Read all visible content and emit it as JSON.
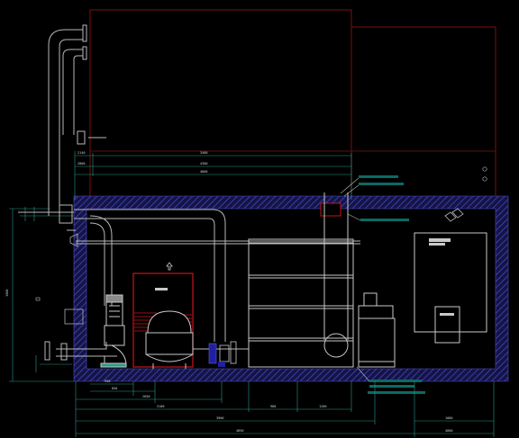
{
  "drawing": {
    "kind": "CAD elevation drawing of a plant room",
    "background_color": "#000000",
    "line_colors": {
      "building_outline": "#7a1010",
      "wall_hatch": "#3a3aa8",
      "equipment": "#b8b8b8",
      "dimension": "#2a9a8a",
      "tag": "#0c6a62",
      "highlight": "#c81414",
      "valve": "#2020a0"
    },
    "dimension_labels": {
      "top_a": "3400",
      "top_b": "4300",
      "top_c": "4800",
      "left_a": "2140",
      "left_b": "2800",
      "left_c": "1300",
      "vertical_total": "1960",
      "bottom_a": "2650",
      "bottom_b": "3100",
      "bottom_c": "3900",
      "bottom_d": "4850",
      "bottom_e": "4800",
      "bottom_f": "1080",
      "seg_a": "950",
      "seg_b": "850",
      "seg_c": "980",
      "seg_d": "1200",
      "seg_e": "2800"
    },
    "icons": {
      "pump": "vertical-pump-icon",
      "filter": "sand-filter-icon",
      "tank": "storage-tank-icon",
      "cabinet": "control-cabinet-icon",
      "heater": "heater-unit-icon",
      "valve": "valve-icon",
      "up_arrow": "up-arrow-icon"
    }
  }
}
